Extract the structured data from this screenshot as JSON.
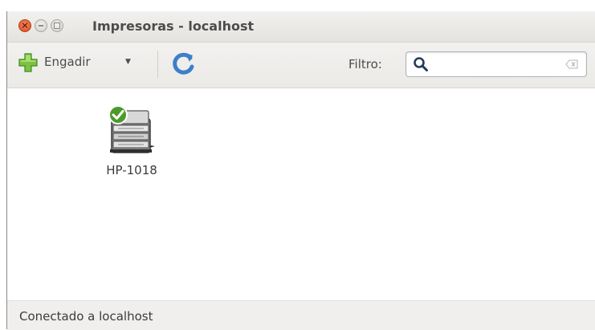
{
  "window": {
    "title": "Impresoras - localhost",
    "close_glyph": "×"
  },
  "toolbar": {
    "add_label": "Engadir",
    "add_dropdown_glyph": "▼",
    "filter_label": "Filtro:",
    "filter_value": ""
  },
  "printers": [
    {
      "name": "HP-1018",
      "status": "ok",
      "icon": "printer-icon"
    }
  ],
  "statusbar": {
    "text": "Conectado a localhost"
  },
  "colors": {
    "accent_green": "#4c9a2a",
    "refresh_blue": "#3d7fc9",
    "close_orange": "#e0582b"
  }
}
